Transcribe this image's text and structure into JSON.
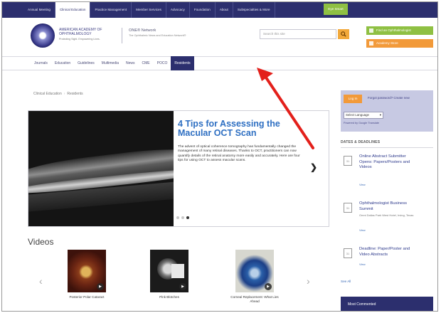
{
  "topnav": {
    "items": [
      "Annual Meeting",
      "Clinical Education",
      "Practice Management",
      "Member Services",
      "Advocacy",
      "Foundation",
      "About",
      "Subspecialties & More"
    ],
    "active_index": 1,
    "shop_label": "Eye Smart"
  },
  "header": {
    "logo_text": "AMERICAN ACADEMY OF OPHTHALMOLOGY",
    "logo_tagline": "Protecting Sight. Empowering Lives.",
    "network_title": "ONE® Network",
    "network_tagline": "The Ophthalmic News and Education Network®",
    "search_placeholder": "Search this site",
    "search_icon": "magnifier-icon",
    "cta_green": "Find an Ophthalmologist",
    "cta_orange": "Academy Store"
  },
  "subnav": {
    "items": [
      "Journals",
      "Education",
      "Guidelines",
      "Multimedia",
      "News",
      "CME",
      "POCO",
      "Residents"
    ],
    "active_index": 7
  },
  "breadcrumb": [
    "Clinical Education",
    "Residents"
  ],
  "hero": {
    "title": "4 Tips for Assessing the Macular OCT Scan",
    "body": "The advent of optical coherence tomography has fundamentally changed the management of many retinal diseases. Thanks to OCT, practitioners can now quantify details of the retinal anatomy more easily and accurately. Here are four tips for using OCT to assess macular scans.",
    "next_icon": "chevron-right-icon",
    "slide_count": 3,
    "active_slide": 2
  },
  "videos": {
    "heading": "Videos",
    "items": [
      {
        "caption": "Posterior Polar Cataract"
      },
      {
        "caption": "Pink Blotches"
      },
      {
        "caption": "Corneal Replacement: What Lies Ahead"
      }
    ]
  },
  "sidebar": {
    "login_label": "Log In",
    "forgot_label": "Forgot password? Create new",
    "language_label": "Select Language",
    "powered_label": "Powered by Google Translate",
    "dates_heading": "DATES & DEADLINES",
    "deadlines": [
      {
        "title": "Online Abstract Submitter Opens: Papers/Posters and Videos",
        "sub": "",
        "view": "View"
      },
      {
        "title": "Ophthalmologist Business Summit",
        "sub": "Omni Dallas Park West Hotel, Irving, Texas",
        "view": "View"
      },
      {
        "title": "Deadline: Paper/Poster and Video Abstracts",
        "sub": "",
        "view": "View"
      }
    ],
    "see_all": "See All",
    "most_commented": "Most Commented"
  },
  "colors": {
    "nav_bg": "#2c2f6e",
    "accent_blue": "#2e6fc2",
    "green": "#8fc043",
    "orange": "#f29a3a",
    "annotation_arrow": "#e3201b"
  }
}
